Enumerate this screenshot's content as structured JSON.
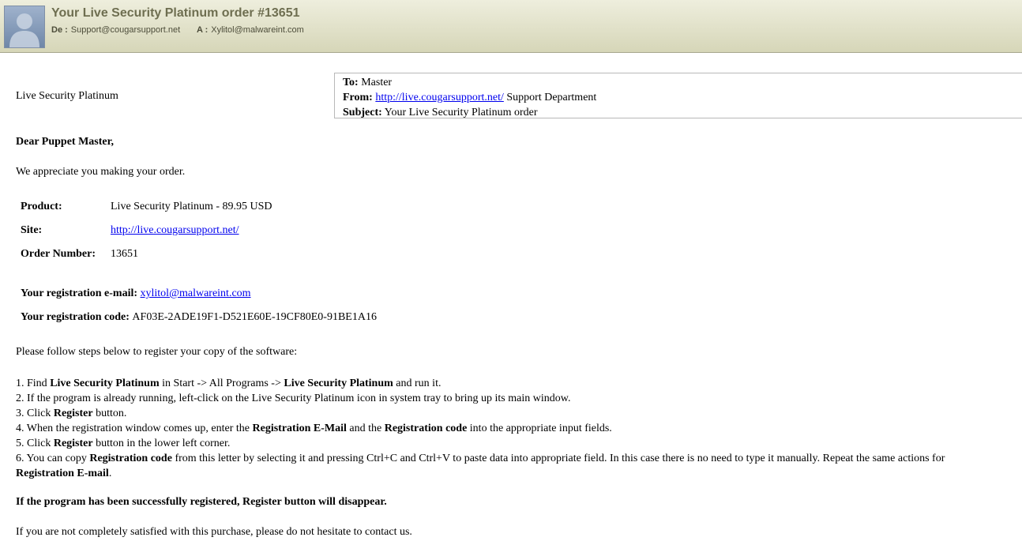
{
  "header": {
    "subject": "Your Live Security Platinum order #13651",
    "from_label": "De :",
    "from_value": "Support@cougarsupport.net",
    "to_label": "A :",
    "to_value": "Xylitol@malwareint.com",
    "avatar_icon": "user-silhouette-icon"
  },
  "body": {
    "brand": "Live Security Platinum",
    "infobox": {
      "to_label": "To:",
      "to_value": "Master",
      "from_label": "From:",
      "from_link": "http://live.cougarsupport.net/",
      "from_suffix": "Support Department",
      "subject_label": "Subject:",
      "subject_value": "Your Live Security Platinum order"
    },
    "greeting": "Dear Puppet Master,",
    "thanks": "We appreciate you making your order.",
    "details": {
      "product_label": "Product:",
      "product_value": "Live Security Platinum - 89.95 USD",
      "site_label": "Site:",
      "site_link": "http://live.cougarsupport.net/",
      "order_label": "Order Number:",
      "order_value": "13651"
    },
    "registration": {
      "email_label": "Your registration e-mail:",
      "email_link": "xylitol@malwareint.com",
      "code_label": "Your registration code:",
      "code_value": "AF03E-2ADE19F1-D521E60E-19CF80E0-91BE1A16"
    },
    "steps_intro": "Please follow steps below to register your copy of the software:",
    "steps": {
      "s1_a": "1. Find ",
      "s1_b": "Live Security Platinum",
      "s1_c": " in Start -> All Programs -> ",
      "s1_d": "Live Security Platinum",
      "s1_e": " and run it.",
      "s2": "2. If the program is already running, left-click on the Live Security Platinum icon in system tray to bring up its main window.",
      "s3_a": "3. Click ",
      "s3_b": "Register",
      "s3_c": " button.",
      "s4_a": "4. When the registration window comes up, enter the ",
      "s4_b": "Registration E-Mail",
      "s4_c": " and the ",
      "s4_d": "Registration code",
      "s4_e": " into the appropriate input fields.",
      "s5_a": "5. Click ",
      "s5_b": "Register",
      "s5_c": " button in the lower left corner.",
      "s6_a": "6. You can copy ",
      "s6_b": "Registration code",
      "s6_c": " from this letter by selecting it and pressing Ctrl+C and Ctrl+V to paste data into appropriate field. In this case there is no need to type it manually. Repeat the same actions for",
      "s6_d": "Registration E-mail",
      "s6_e": "."
    },
    "success_note": "If the program has been successfully registered, Register button will disappear.",
    "closing": "If you are not completely satisfied with this purchase, please do not hesitate to contact us."
  }
}
